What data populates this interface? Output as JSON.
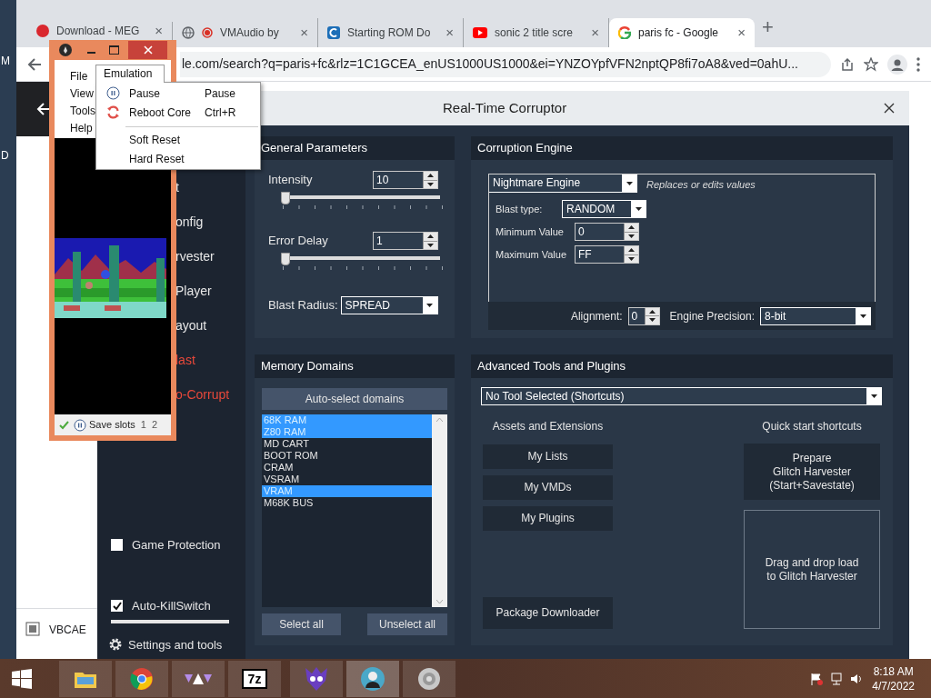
{
  "desktop": {
    "icon_labels": [
      "M",
      "D"
    ]
  },
  "browser": {
    "tabs": [
      {
        "title": "Download - MEG",
        "selected": false,
        "close": "×"
      },
      {
        "title": "VMAudio by",
        "selected": false,
        "close": "×"
      },
      {
        "title": "Starting ROM Do",
        "selected": false,
        "close": "×"
      },
      {
        "title": "sonic 2 title scre",
        "selected": false,
        "close": "×"
      },
      {
        "title": "paris fc - Google",
        "selected": true,
        "close": "×"
      }
    ],
    "new_tab": "+",
    "address": "le.com/search?q=paris+fc&rlz=1C1GCEA_enUS1000US1000&ei=YNZOYpfVFN2nptQP8fi7oA8&ved=0ahU...",
    "page_item": "VBCAE"
  },
  "rtc": {
    "title": "Real-Time Corruptor",
    "sidebar": {
      "items": [
        {
          "label": "t",
          "accent": false
        },
        {
          "label": "onfig",
          "accent": false
        },
        {
          "label": "rvester",
          "accent": false
        },
        {
          "label": "Player",
          "accent": false
        },
        {
          "label": "ayout",
          "accent": false
        },
        {
          "label": "last",
          "accent": true
        },
        {
          "label": "o-Corrupt",
          "accent": true
        }
      ],
      "options": [
        {
          "label": "Game Protection",
          "checked": false
        },
        {
          "label": "Auto-KillSwitch",
          "checked": true
        }
      ],
      "settings": "Settings and tools"
    },
    "general": {
      "title": "General Parameters",
      "sliders": [
        {
          "label": "Intensity",
          "value": "10",
          "level": 0.02
        },
        {
          "label": "Error Delay",
          "value": "1",
          "level": 0.02
        }
      ],
      "blast_radius": {
        "label": "Blast Radius:",
        "value": "SPREAD"
      }
    },
    "engine": {
      "title": "Corruption Engine",
      "engine": "Nightmare Engine",
      "description": "Replaces or edits values",
      "blast_type": {
        "label": "Blast type:",
        "value": "RANDOM"
      },
      "fields": [
        {
          "label": "Minimum Value",
          "value": "0"
        },
        {
          "label": "Maximum Value",
          "value": "FF"
        }
      ],
      "alignment": {
        "label": "Alignment:",
        "value": "0"
      },
      "precision": {
        "label": "Engine Precision:",
        "value": "8-bit"
      }
    },
    "memory": {
      "title": "Memory Domains",
      "auto_button": "Auto-select domains",
      "domains": [
        {
          "name": "68K RAM",
          "selected": true
        },
        {
          "name": "Z80 RAM",
          "selected": true
        },
        {
          "name": "MD CART",
          "selected": false
        },
        {
          "name": "BOOT ROM",
          "selected": false
        },
        {
          "name": "CRAM",
          "selected": false
        },
        {
          "name": "VSRAM",
          "selected": false
        },
        {
          "name": "VRAM",
          "selected": true
        },
        {
          "name": "M68K BUS",
          "selected": false
        }
      ],
      "select_all": "Select all",
      "unselect_all": "Unselect all"
    },
    "tools": {
      "title": "Advanced Tools and Plugins",
      "tool": "No Tool Selected (Shortcuts)",
      "assets_title": "Assets and Extensions",
      "asset_buttons": [
        "My Lists",
        "My VMDs",
        "My Plugins"
      ],
      "package_button": "Package Downloader",
      "quick_title": "Quick start shortcuts",
      "prepare_lines": [
        "Prepare",
        "Glitch Harvester",
        "(Start+Savestate)"
      ],
      "drop_lines": [
        "Drag and drop load",
        "to Glitch Harvester"
      ]
    }
  },
  "emulator": {
    "menu": [
      "File",
      "View",
      "Tools",
      "Help"
    ],
    "open_menu": "Emulation",
    "menu_items": [
      {
        "kind": "pause_item",
        "label": "Pause",
        "shortcut": "Pause"
      },
      {
        "kind": "reboot_item",
        "label": "Reboot Core",
        "shortcut": "Ctrl+R"
      },
      {
        "kind": "separator"
      },
      {
        "kind": "item",
        "label": "Soft Reset"
      },
      {
        "kind": "item",
        "label": "Hard Reset"
      }
    ],
    "status": {
      "label": "Save slots",
      "slots": [
        "1",
        "2"
      ]
    }
  },
  "taskbar": {
    "archive_label": "7z",
    "time": "8:18 AM",
    "date": "4/7/2022"
  }
}
